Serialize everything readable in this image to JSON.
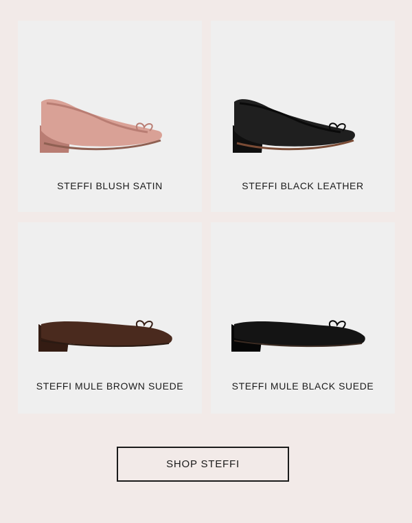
{
  "products": [
    {
      "name": "STEFFI BLUSH SATIN",
      "style": "ballet",
      "colors": {
        "upper": "#d9a196",
        "shade": "#b97d73",
        "sole": "#8f6052"
      }
    },
    {
      "name": "STEFFI BLACK LEATHER",
      "style": "ballet",
      "colors": {
        "upper": "#1f1f1f",
        "shade": "#0f0f0f",
        "sole": "#7a4b35"
      }
    },
    {
      "name": "STEFFI MULE BROWN SUEDE",
      "style": "mule",
      "colors": {
        "upper": "#4a2a1e",
        "shade": "#341c13",
        "sole": "#2a1a12"
      }
    },
    {
      "name": "STEFFI MULE BLACK SUEDE",
      "style": "mule",
      "colors": {
        "upper": "#141414",
        "shade": "#070707",
        "sole": "#3b2b22"
      }
    }
  ],
  "cta": {
    "label": "SHOP STEFFI"
  },
  "colors": {
    "background": "#f2eae8",
    "card": "#efefef",
    "text": "#1a1a1a"
  }
}
